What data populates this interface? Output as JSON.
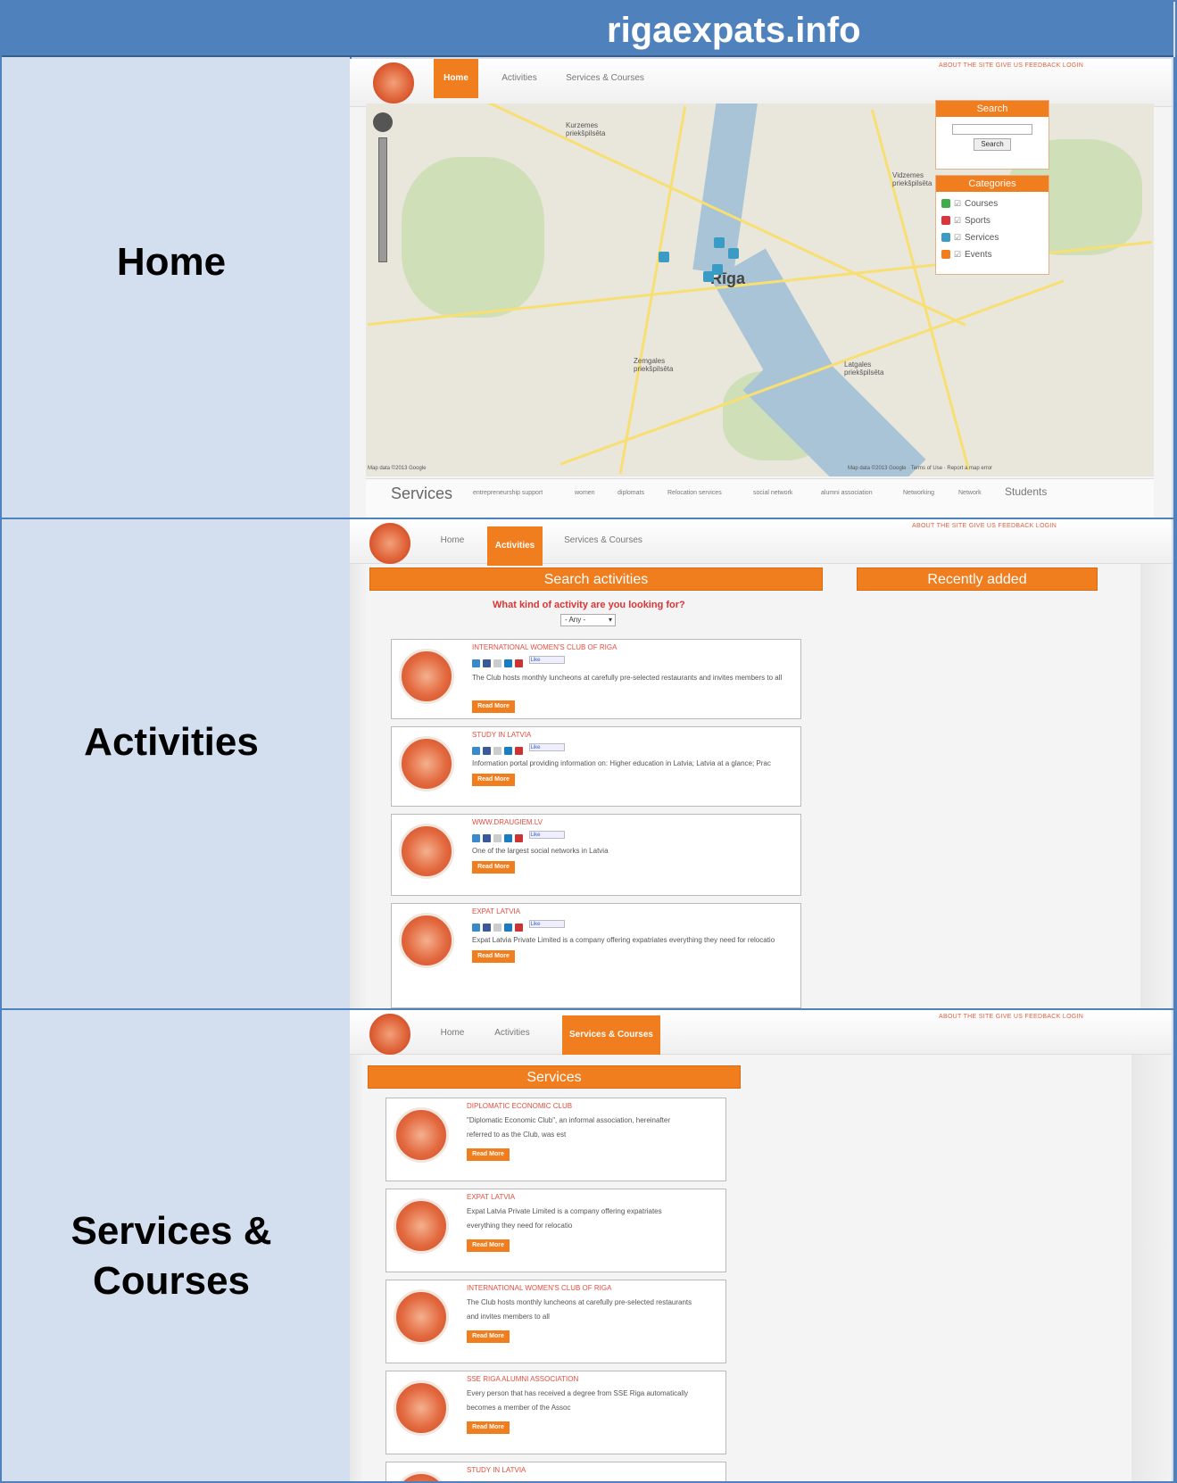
{
  "header": {
    "title": "rigaexpats.info"
  },
  "rows": [
    {
      "label": "Home"
    },
    {
      "label": "Activities"
    },
    {
      "label": "Services &\nCourses"
    }
  ],
  "site": {
    "nav": {
      "home": "Home",
      "activities": "Activities",
      "services": "Services & Courses"
    },
    "toplinks": "ABOUT THE SITE   GIVE US FEEDBACK   LOGIN"
  },
  "home": {
    "map": {
      "city": "Rīga",
      "labels": [
        "Kurzemes priekšpilsēta",
        "Vidzemes priekšpilsēta",
        "Zemgales priekšpilsēta",
        "Latgales priekšpilsēta"
      ],
      "attribution_left": "Map data ©2013 Google",
      "attribution_right": "Map data ©2013 Google · Terms of Use · Report a map error"
    },
    "search_panel": {
      "title": "Search",
      "button": "Search"
    },
    "categories_panel": {
      "title": "Categories",
      "items": [
        {
          "label": "Courses",
          "color": "#3fae49"
        },
        {
          "label": "Sports",
          "color": "#d9363e"
        },
        {
          "label": "Services",
          "color": "#3a9bc4"
        },
        {
          "label": "Events",
          "color": "#f07d1e"
        }
      ]
    },
    "services_bar": {
      "title": "Services",
      "tags": [
        "entrepreneurship support",
        "women",
        "diplomats",
        "Relocation services",
        "social network",
        "alumni association",
        "Networking",
        "Network",
        "Students"
      ]
    }
  },
  "activities": {
    "search_title": "Search activities",
    "recent_title": "Recently added",
    "question": "What kind of activity are you looking for?",
    "select_value": "- Any -",
    "read_more": "Read More",
    "like": "Like",
    "cards": [
      {
        "title": "INTERNATIONAL WOMEN'S CLUB OF RIGA",
        "desc": "The Club hosts monthly luncheons at carefully pre-selected restaurants and invites members to all"
      },
      {
        "title": "STUDY IN LATVIA",
        "desc": "Information portal providing information on: Higher education in Latvia; Latvia at a glance; Prac"
      },
      {
        "title": "WWW.DRAUGIEM.LV",
        "desc": "One of the largest social networks in Latvia"
      },
      {
        "title": "EXPAT LATVIA",
        "desc": "Expat Latvia Private Limited is a company offering expatriates everything they need for relocatio"
      }
    ]
  },
  "services": {
    "title": "Services",
    "read_more": "Read More",
    "cards": [
      {
        "title": "DIPLOMATIC ECONOMIC CLUB",
        "desc1": "\"Diplomatic Economic Club\", an informal association, hereinafter",
        "desc2": "referred to as the Club, was est"
      },
      {
        "title": "EXPAT LATVIA",
        "desc1": "Expat Latvia Private Limited is a company offering expatriates",
        "desc2": "everything they need for relocatio"
      },
      {
        "title": "INTERNATIONAL WOMEN'S CLUB OF RIGA",
        "desc1": "The Club hosts monthly luncheons at carefully pre-selected restaurants",
        "desc2": "and invites members to all"
      },
      {
        "title": "SSE RIGA ALUMNI ASSOCIATION",
        "desc1": "Every person that has received a degree from SSE Riga automatically",
        "desc2": "becomes a member of the Assoc"
      },
      {
        "title": "STUDY IN LATVIA",
        "desc1": "",
        "desc2": ""
      }
    ]
  }
}
